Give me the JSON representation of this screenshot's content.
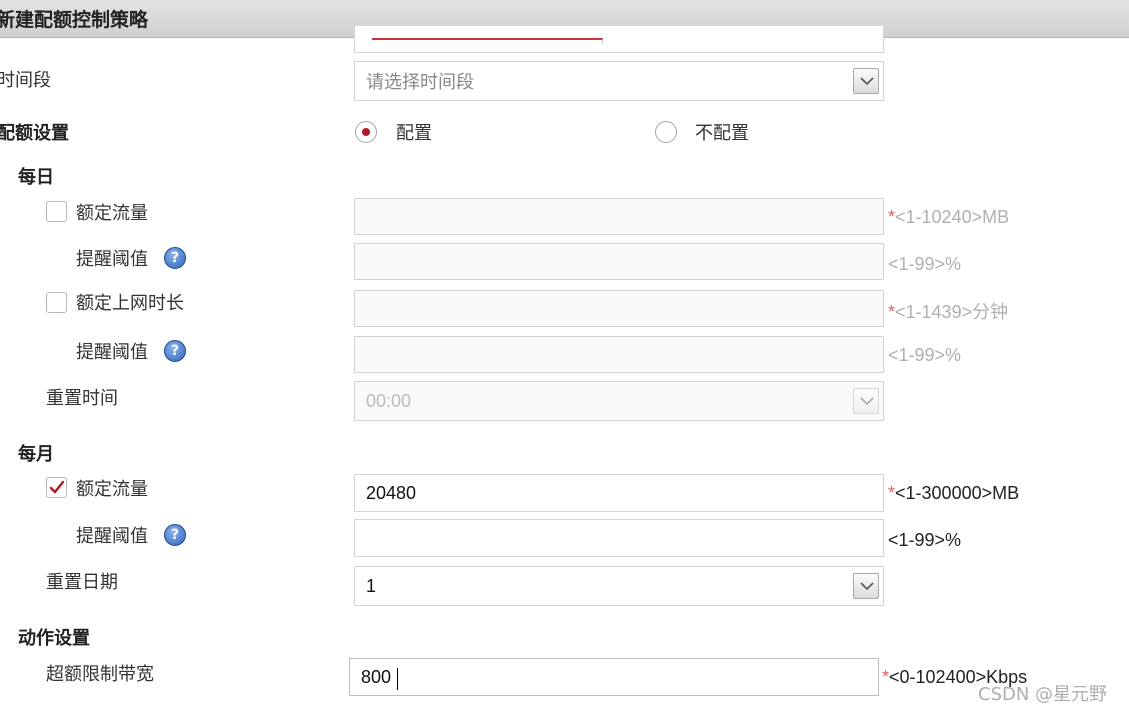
{
  "header": {
    "title": "新建配额控制策略"
  },
  "time_period": {
    "label": "时间段",
    "placeholder": "请选择时间段"
  },
  "quota_settings": {
    "label": "配额设置",
    "option_configure": "配置",
    "option_not_configure": "不配置",
    "selected": "配置"
  },
  "daily": {
    "label": "每日",
    "quota_traffic": {
      "label": "额定流量",
      "checked": false,
      "value": "",
      "hint_star": "*",
      "hint": "<1-10240>MB"
    },
    "traffic_threshold": {
      "label": "提醒阈值",
      "value": "",
      "hint": "<1-99>%"
    },
    "quota_online_time": {
      "label": "额定上网时长",
      "checked": false,
      "value": "",
      "hint_star": "*",
      "hint": "<1-1439>分钟"
    },
    "time_threshold": {
      "label": "提醒阈值",
      "value": "",
      "hint": "<1-99>%"
    },
    "reset_time": {
      "label": "重置时间",
      "value": "00:00"
    }
  },
  "monthly": {
    "label": "每月",
    "quota_traffic": {
      "label": "额定流量",
      "checked": true,
      "value": "20480",
      "hint_star": "*",
      "hint": "<1-300000>MB"
    },
    "traffic_threshold": {
      "label": "提醒阈值",
      "value": "",
      "hint": "<1-99>%"
    },
    "reset_date": {
      "label": "重置日期",
      "value": "1"
    }
  },
  "action": {
    "label": "动作设置",
    "over_quota_bandwidth": {
      "label": "超额限制带宽",
      "value": "800",
      "hint_star": "*",
      "hint": "<0-102400>Kbps"
    }
  },
  "help_icon_glyph": "?",
  "watermark": "CSDN @星元野",
  "colors": {
    "radio_selected": "#b01822",
    "check_mark": "#b01822",
    "required_star": "#e06060",
    "help_icon": "#2f62b6"
  }
}
